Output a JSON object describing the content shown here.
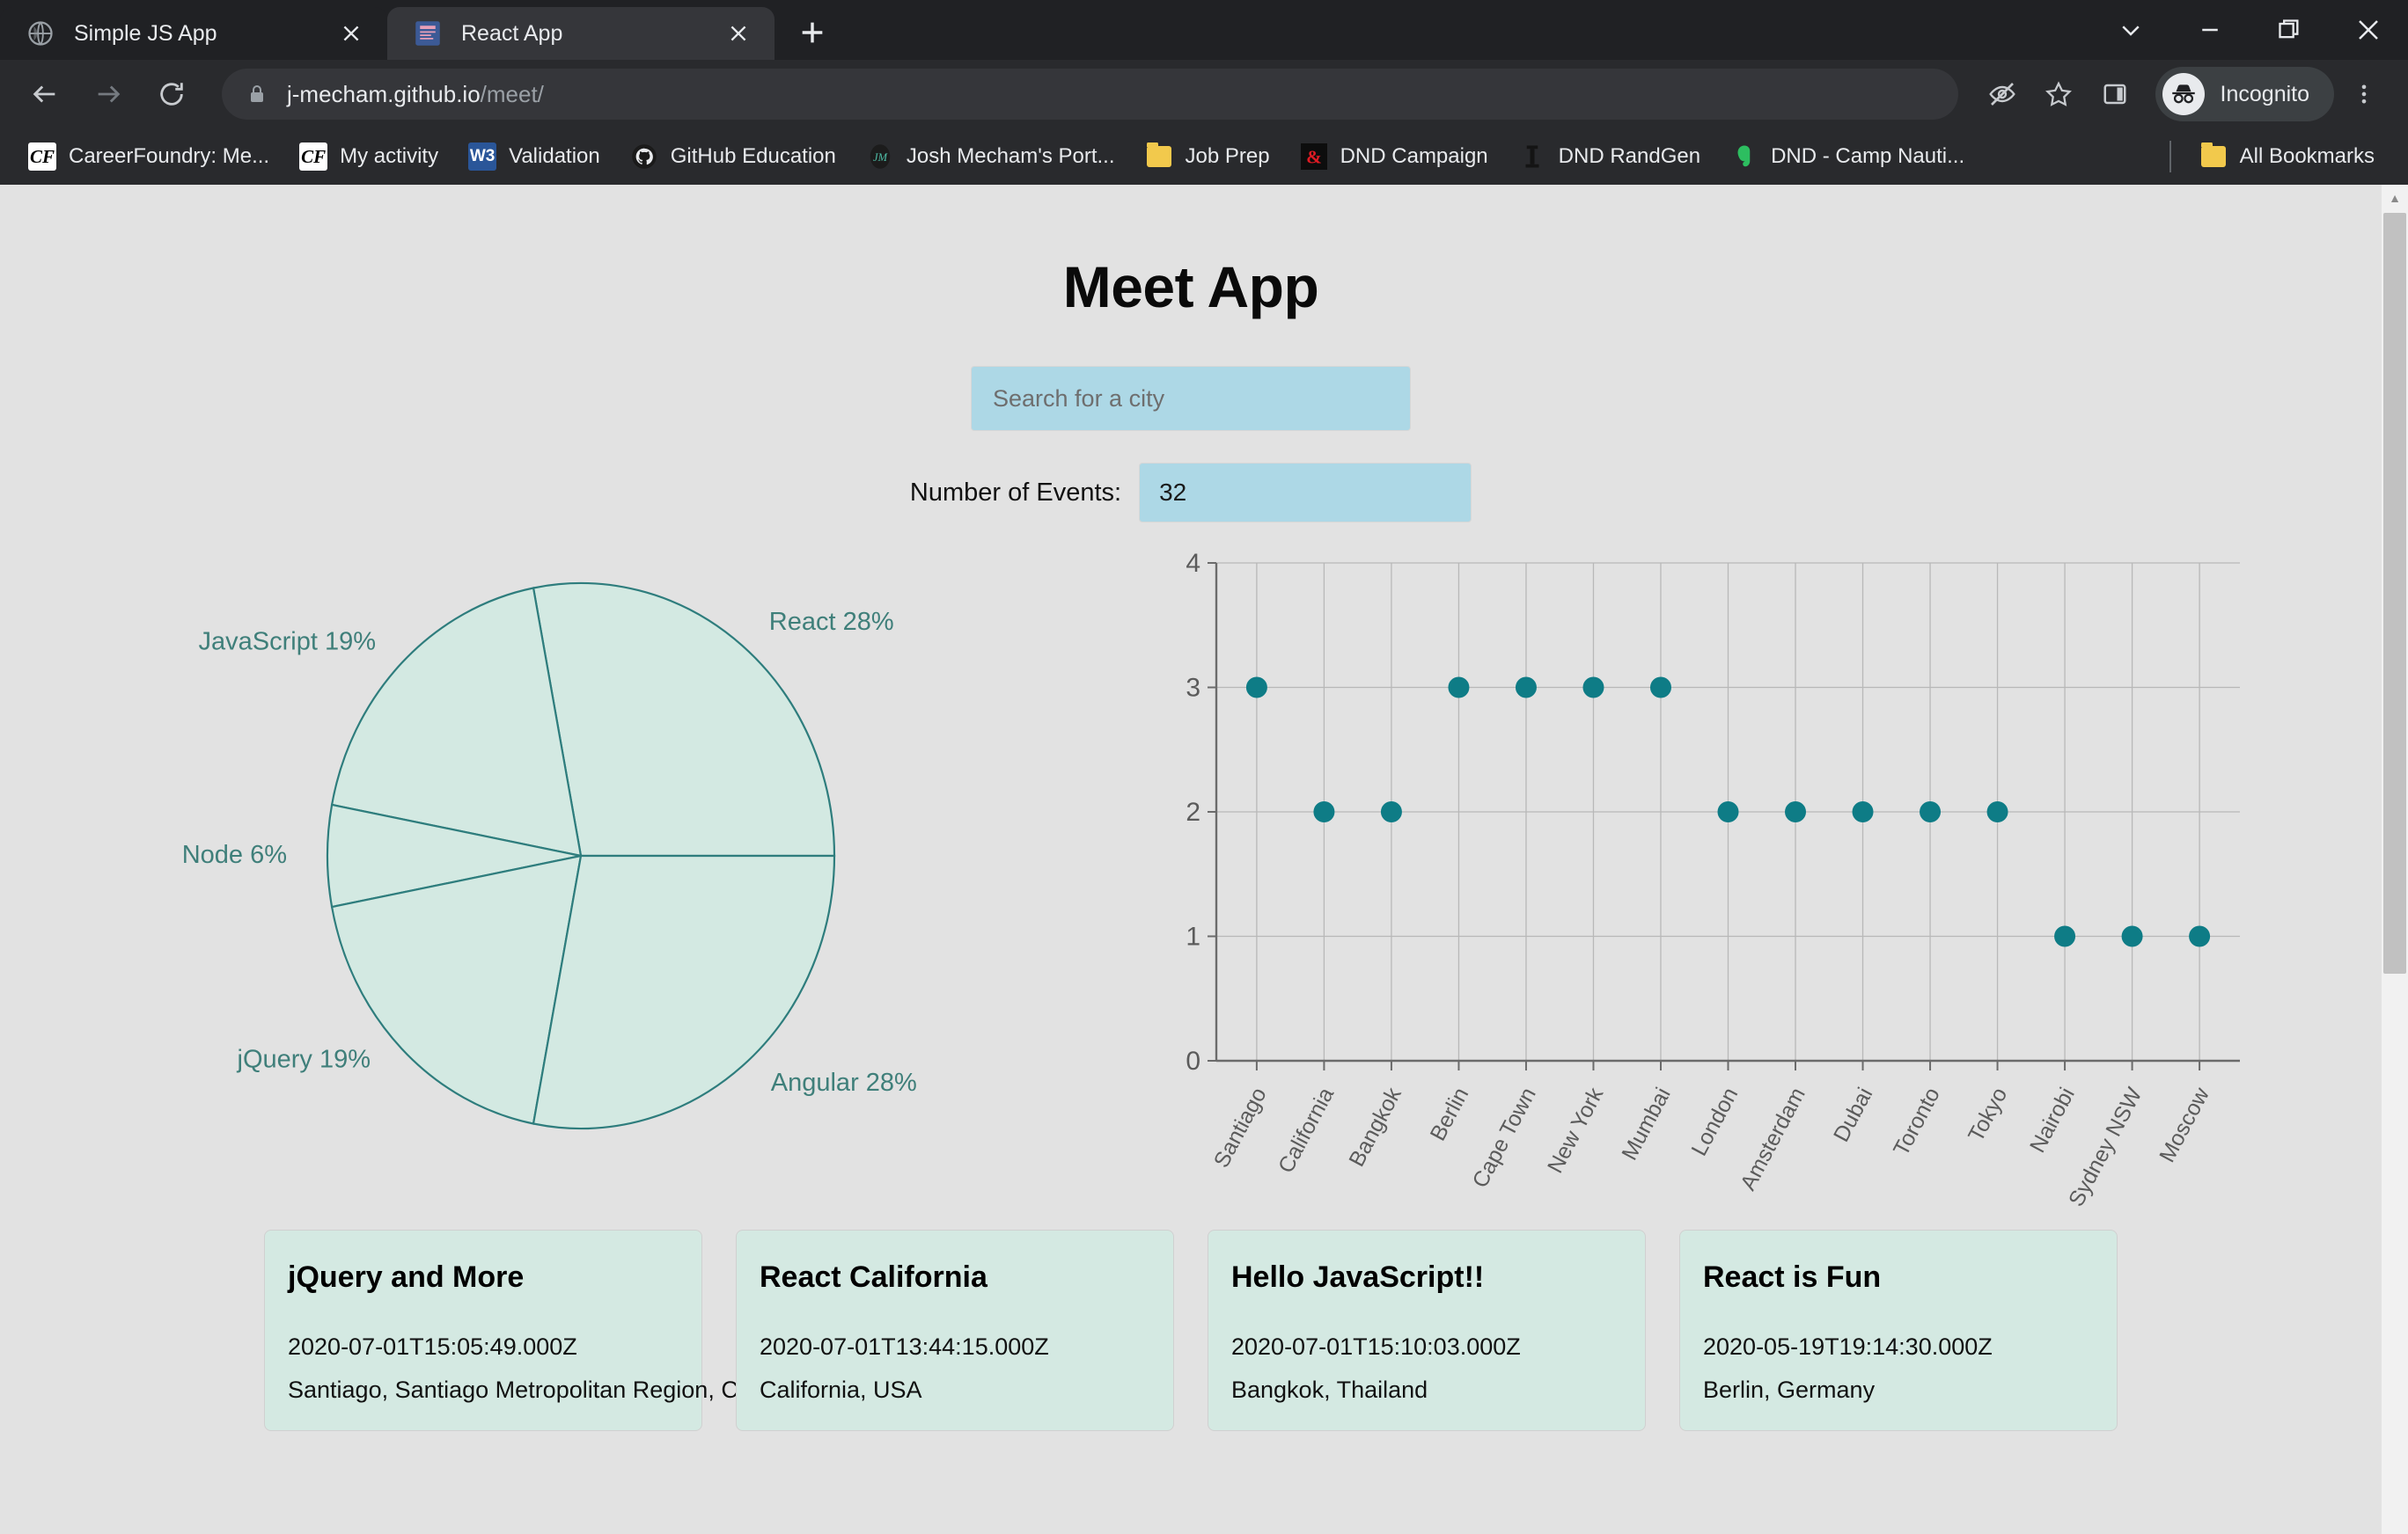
{
  "browser": {
    "tabs": [
      {
        "title": "Simple JS App",
        "favicon": "globe-icon",
        "active": false
      },
      {
        "title": "React App",
        "favicon": "react-app-icon",
        "active": true
      }
    ],
    "new_tab_label": "+",
    "window_controls": {
      "minimize_all": "chevron-down-icon",
      "minimize": "minimize-icon",
      "maximize": "maximize-icon",
      "close": "close-icon"
    },
    "nav": {
      "back": "back-arrow-icon",
      "forward": "forward-arrow-icon",
      "reload": "reload-icon"
    },
    "omnibox": {
      "lock": "lock-icon",
      "domain": "j-mecham.github.io",
      "path": "/meet/"
    },
    "toolbar_icons": [
      "eye-crossed-icon",
      "star-bookmark-icon",
      "side-panel-icon"
    ],
    "profile": {
      "label": "Incognito",
      "icon": "incognito-icon"
    },
    "menu_icon": "three-dot-menu-icon",
    "bookmarks": [
      {
        "label": "CareerFoundry: Me...",
        "icon": "cf-icon"
      },
      {
        "label": "My activity",
        "icon": "cf-icon"
      },
      {
        "label": "Validation",
        "icon": "w3-icon"
      },
      {
        "label": "GitHub Education",
        "icon": "github-icon"
      },
      {
        "label": "Josh Mecham's Port...",
        "icon": "jm-monogram-icon"
      },
      {
        "label": "Job Prep",
        "icon": "folder-icon"
      },
      {
        "label": "DND Campaign",
        "icon": "ampersand-icon"
      },
      {
        "label": "DND RandGen",
        "icon": "dice-tower-icon"
      },
      {
        "label": "DND - Camp Nauti...",
        "icon": "evernote-icon"
      }
    ],
    "all_bookmarks": {
      "label": "All Bookmarks",
      "icon": "folder-icon"
    },
    "scrollbar": {
      "up_arrow": "triangle-up-icon"
    }
  },
  "app": {
    "title": "Meet App",
    "search": {
      "placeholder": "Search for a city",
      "value": ""
    },
    "number_of_events": {
      "label": "Number of Events:",
      "value": "32"
    },
    "colors": {
      "input_bg": "#add8e6",
      "page_bg": "#e2e2e2",
      "card_bg": "#d4e9e2",
      "chart_accent": "#2b7e8c",
      "pie_fill": "#d3e9e2",
      "pie_stroke": "#2e7d7d",
      "label_color": "#3f7f7a"
    },
    "events": [
      {
        "title": "jQuery and More",
        "date": "2020-07-01T15:05:49.000Z",
        "location": "Santiago, Santiago Metropolitan Region, Chile"
      },
      {
        "title": "React California",
        "date": "2020-07-01T13:44:15.000Z",
        "location": "California, USA"
      },
      {
        "title": "Hello JavaScript!!",
        "date": "2020-07-01T15:10:03.000Z",
        "location": "Bangkok, Thailand"
      },
      {
        "title": "React is Fun",
        "date": "2020-05-19T19:14:30.000Z",
        "location": "Berlin, Germany"
      }
    ]
  },
  "chart_data": [
    {
      "type": "pie",
      "title": "",
      "labels": [
        "React",
        "Angular",
        "jQuery",
        "Node",
        "JavaScript"
      ],
      "values": [
        28,
        28,
        19,
        6,
        19
      ],
      "label_texts": [
        "React 28%",
        "Angular 28%",
        "jQuery 19%",
        "Node 6%",
        "JavaScript 19%"
      ],
      "unit": "%",
      "legend": "outside-labels",
      "fill": "#d3e9e2",
      "stroke": "#2e7d7d"
    },
    {
      "type": "scatter",
      "title": "",
      "xlabel": "",
      "ylabel": "",
      "categories": [
        "Santiago",
        "California",
        "Bangkok",
        "Berlin",
        "Cape Town",
        "New York",
        "Mumbai",
        "London",
        "Amsterdam",
        "Dubai",
        "Toronto",
        "Tokyo",
        "Nairobi",
        "Sydney NSW",
        "Moscow"
      ],
      "values": [
        3,
        2,
        2,
        3,
        3,
        3,
        3,
        2,
        2,
        2,
        2,
        2,
        1,
        1,
        1
      ],
      "ylim": [
        0,
        4
      ],
      "yticks": [
        "0",
        "1",
        "2",
        "3",
        "4"
      ],
      "grid": true,
      "point_color": "#0e7c86"
    }
  ]
}
